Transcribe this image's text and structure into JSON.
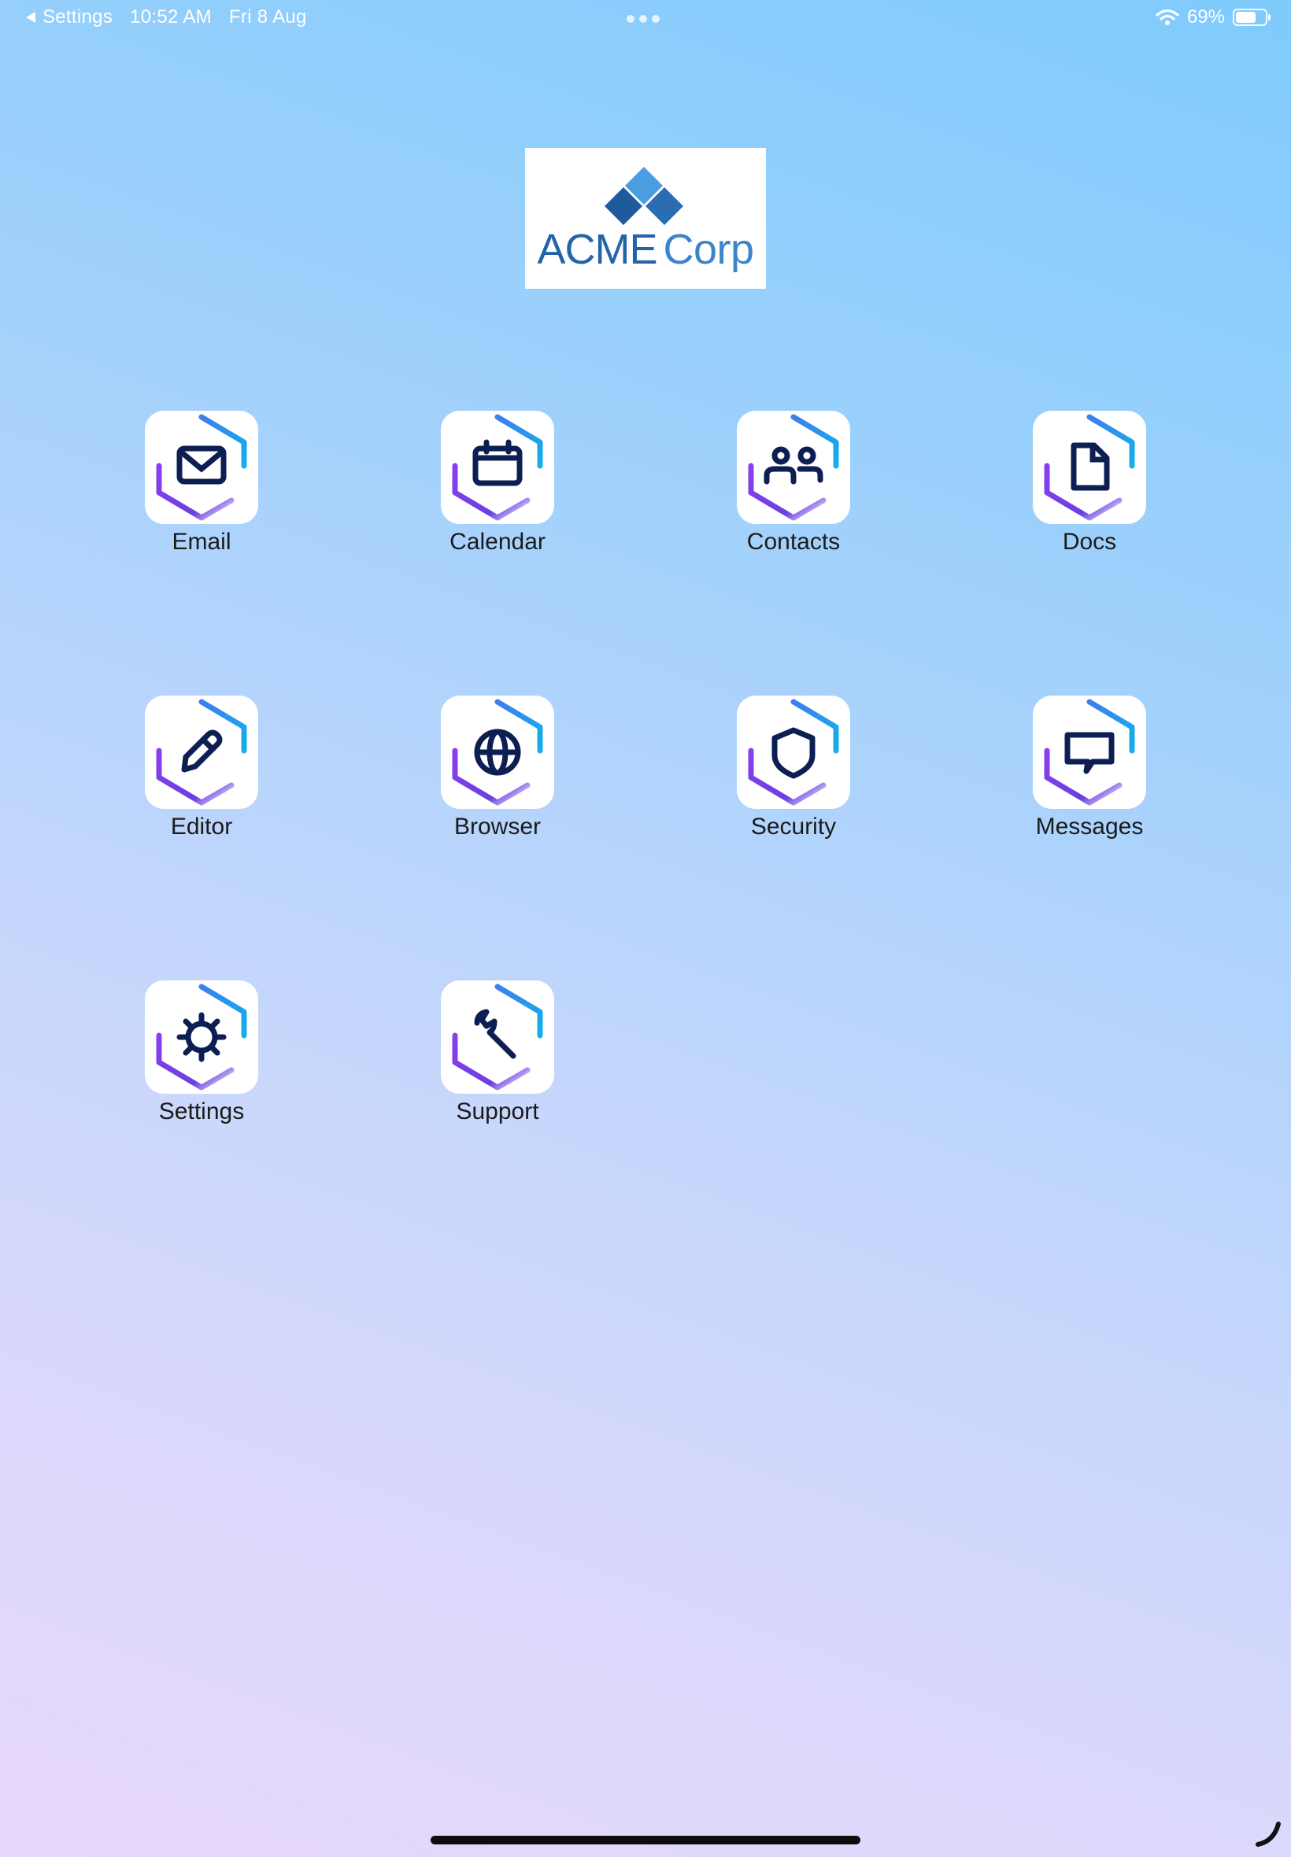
{
  "status_bar": {
    "back_label": "Settings",
    "time": "10:52 AM",
    "date": "Fri 8 Aug",
    "battery_percent": "69%",
    "battery_level": 0.69,
    "wifi_icon": "wifi-icon",
    "battery_icon": "battery-icon",
    "multitasking_icon": "ellipsis-icon"
  },
  "logo": {
    "text_acme": "ACME",
    "text_corp": "Corp",
    "colors": {
      "dark": "#2364a8",
      "light": "#3a84c9"
    }
  },
  "apps": [
    {
      "label": "Email",
      "icon": "envelope-icon"
    },
    {
      "label": "Calendar",
      "icon": "calendar-icon"
    },
    {
      "label": "Contacts",
      "icon": "people-icon"
    },
    {
      "label": "Docs",
      "icon": "document-icon"
    },
    {
      "label": "Editor",
      "icon": "pencil-icon"
    },
    {
      "label": "Browser",
      "icon": "globe-icon"
    },
    {
      "label": "Security",
      "icon": "shield-icon"
    },
    {
      "label": "Messages",
      "icon": "chat-bubble-icon"
    },
    {
      "label": "Settings",
      "icon": "gear-icon"
    },
    {
      "label": "Support",
      "icon": "wrench-icon"
    }
  ],
  "colors": {
    "hex_purple": "#7b3fe4",
    "hex_blue": "#1aa3e8",
    "glyph": "#0d1f52"
  }
}
